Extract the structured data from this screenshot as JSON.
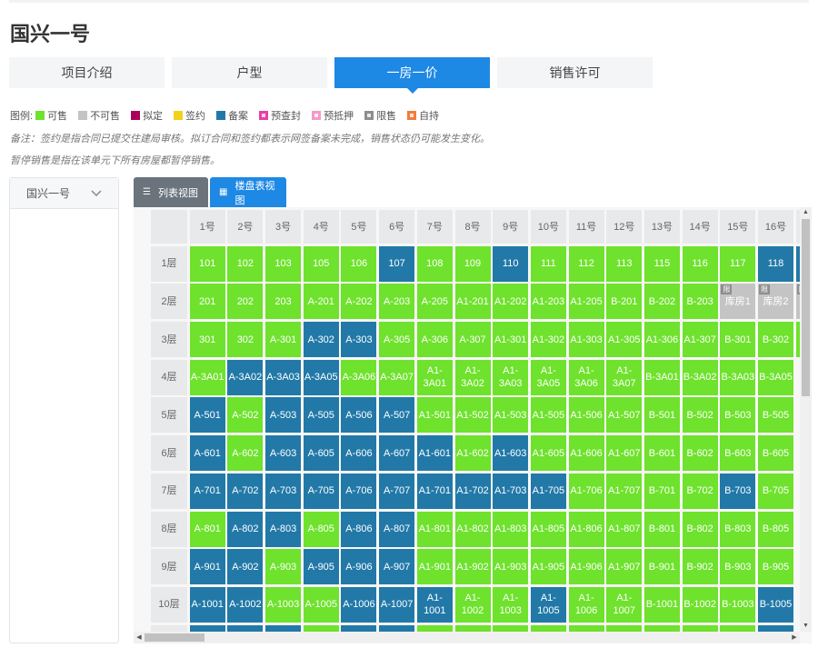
{
  "title": "国兴一号",
  "tabs": [
    {
      "label": "项目介绍",
      "active": false
    },
    {
      "label": "户型",
      "active": false
    },
    {
      "label": "一房一价",
      "active": true
    },
    {
      "label": "销售许可",
      "active": false
    }
  ],
  "legend": {
    "prefix": "图例:",
    "items": [
      {
        "label": "可售",
        "color": "#6ee22c"
      },
      {
        "label": "不可售",
        "color": "#c4c4c4"
      },
      {
        "label": "拟定",
        "color": "#a8005a"
      },
      {
        "label": "签约",
        "color": "#f2d21e"
      },
      {
        "label": "备案",
        "color": "#2279a8"
      },
      {
        "label": "预查封",
        "color": "#e83fa9",
        "dot": true
      },
      {
        "label": "预抵押",
        "color": "#f49ac8",
        "dot": true
      },
      {
        "label": "限售",
        "color": "#8e8e8e",
        "dot": true
      },
      {
        "label": "自持",
        "color": "#f27b3b",
        "dot": true
      }
    ]
  },
  "notes": [
    "备注：签约是指合同已提交住建局审核。拟订合同和签约都表示网签备案未完成，销售状态仍可能发生变化。",
    "暂停销售是指在该单元下所有房屋都暂停销售。"
  ],
  "sidebar": {
    "building": "国兴一号"
  },
  "view_tabs": {
    "list": "列表视图",
    "grid": "楼盘表视图",
    "active": "grid"
  },
  "status_colors": {
    "a": "#6ee22c",
    "b": "#2279a8",
    "x": "#c4c4c4"
  },
  "restricted_badge": "限",
  "grid": {
    "columns": [
      "1号",
      "2号",
      "3号",
      "4号",
      "5号",
      "6号",
      "7号",
      "8号",
      "9号",
      "10号",
      "11号",
      "12号",
      "13号",
      "14号",
      "15号",
      "16号",
      ""
    ],
    "rows": [
      {
        "floor": "1层",
        "cells": [
          [
            "101",
            "a"
          ],
          [
            "102",
            "a"
          ],
          [
            "103",
            "a"
          ],
          [
            "105",
            "a"
          ],
          [
            "106",
            "a"
          ],
          [
            "107",
            "b"
          ],
          [
            "108",
            "a"
          ],
          [
            "109",
            "a"
          ],
          [
            "110",
            "b"
          ],
          [
            "111",
            "a"
          ],
          [
            "112",
            "a"
          ],
          [
            "113",
            "a"
          ],
          [
            "115",
            "a"
          ],
          [
            "116",
            "a"
          ],
          [
            "117",
            "a"
          ],
          [
            "118",
            "b"
          ],
          [
            "",
            "b"
          ]
        ]
      },
      {
        "floor": "2层",
        "cells": [
          [
            "201",
            "a"
          ],
          [
            "202",
            "a"
          ],
          [
            "203",
            "a"
          ],
          [
            "A-201",
            "a"
          ],
          [
            "A-202",
            "a"
          ],
          [
            "A-203",
            "a"
          ],
          [
            "A-205",
            "a"
          ],
          [
            "A1-201",
            "a"
          ],
          [
            "A1-202",
            "a"
          ],
          [
            "A1-203",
            "a"
          ],
          [
            "A1-205",
            "a"
          ],
          [
            "B-201",
            "a"
          ],
          [
            "B-202",
            "a"
          ],
          [
            "B-203",
            "a"
          ],
          [
            "库房1",
            "x"
          ],
          [
            "库房2",
            "x"
          ],
          [
            "",
            "x"
          ]
        ]
      },
      {
        "floor": "3层",
        "cells": [
          [
            "301",
            "a"
          ],
          [
            "302",
            "a"
          ],
          [
            "A-301",
            "a"
          ],
          [
            "A-302",
            "b"
          ],
          [
            "A-303",
            "b"
          ],
          [
            "A-305",
            "a"
          ],
          [
            "A-306",
            "a"
          ],
          [
            "A-307",
            "a"
          ],
          [
            "A1-301",
            "a"
          ],
          [
            "A1-302",
            "a"
          ],
          [
            "A1-303",
            "a"
          ],
          [
            "A1-305",
            "a"
          ],
          [
            "A1-306",
            "a"
          ],
          [
            "A1-307",
            "a"
          ],
          [
            "B-301",
            "a"
          ],
          [
            "B-302",
            "a"
          ],
          [
            "",
            "a"
          ]
        ]
      },
      {
        "floor": "4层",
        "cells": [
          [
            "A-3A01",
            "a"
          ],
          [
            "A-3A02",
            "b"
          ],
          [
            "A-3A03",
            "b"
          ],
          [
            "A-3A05",
            "b"
          ],
          [
            "A-3A06",
            "a"
          ],
          [
            "A-3A07",
            "a"
          ],
          [
            "A1-3A01",
            "a"
          ],
          [
            "A1-3A02",
            "a"
          ],
          [
            "A1-3A03",
            "a"
          ],
          [
            "A1-3A05",
            "a"
          ],
          [
            "A1-3A06",
            "a"
          ],
          [
            "A1-3A07",
            "a"
          ],
          [
            "B-3A01",
            "a"
          ],
          [
            "B-3A02",
            "a"
          ],
          [
            "B-3A03",
            "a"
          ],
          [
            "B-3A05",
            "a"
          ]
        ]
      },
      {
        "floor": "5层",
        "cells": [
          [
            "A-501",
            "b"
          ],
          [
            "A-502",
            "a"
          ],
          [
            "A-503",
            "b"
          ],
          [
            "A-505",
            "b"
          ],
          [
            "A-506",
            "b"
          ],
          [
            "A-507",
            "b"
          ],
          [
            "A1-501",
            "a"
          ],
          [
            "A1-502",
            "a"
          ],
          [
            "A1-503",
            "a"
          ],
          [
            "A1-505",
            "a"
          ],
          [
            "A1-506",
            "a"
          ],
          [
            "A1-507",
            "a"
          ],
          [
            "B-501",
            "a"
          ],
          [
            "B-502",
            "a"
          ],
          [
            "B-503",
            "a"
          ],
          [
            "B-505",
            "a"
          ]
        ]
      },
      {
        "floor": "6层",
        "cells": [
          [
            "A-601",
            "b"
          ],
          [
            "A-602",
            "a"
          ],
          [
            "A-603",
            "b"
          ],
          [
            "A-605",
            "b"
          ],
          [
            "A-606",
            "b"
          ],
          [
            "A-607",
            "b"
          ],
          [
            "A1-601",
            "b"
          ],
          [
            "A1-602",
            "a"
          ],
          [
            "A1-603",
            "b"
          ],
          [
            "A1-605",
            "a"
          ],
          [
            "A1-606",
            "a"
          ],
          [
            "A1-607",
            "a"
          ],
          [
            "B-601",
            "a"
          ],
          [
            "B-602",
            "a"
          ],
          [
            "B-603",
            "a"
          ],
          [
            "B-605",
            "a"
          ]
        ]
      },
      {
        "floor": "7层",
        "cells": [
          [
            "A-701",
            "b"
          ],
          [
            "A-702",
            "b"
          ],
          [
            "A-703",
            "b"
          ],
          [
            "A-705",
            "b"
          ],
          [
            "A-706",
            "b"
          ],
          [
            "A-707",
            "b"
          ],
          [
            "A1-701",
            "b"
          ],
          [
            "A1-702",
            "b"
          ],
          [
            "A1-703",
            "b"
          ],
          [
            "A1-705",
            "b"
          ],
          [
            "A1-706",
            "a"
          ],
          [
            "A1-707",
            "a"
          ],
          [
            "B-701",
            "a"
          ],
          [
            "B-702",
            "a"
          ],
          [
            "B-703",
            "b"
          ],
          [
            "B-705",
            "a"
          ]
        ]
      },
      {
        "floor": "8层",
        "cells": [
          [
            "A-801",
            "a"
          ],
          [
            "A-802",
            "b"
          ],
          [
            "A-803",
            "b"
          ],
          [
            "A-805",
            "a"
          ],
          [
            "A-806",
            "b"
          ],
          [
            "A-807",
            "b"
          ],
          [
            "A1-801",
            "a"
          ],
          [
            "A1-802",
            "a"
          ],
          [
            "A1-803",
            "a"
          ],
          [
            "A1-805",
            "a"
          ],
          [
            "A1-806",
            "a"
          ],
          [
            "A1-807",
            "a"
          ],
          [
            "B-801",
            "a"
          ],
          [
            "B-802",
            "a"
          ],
          [
            "B-803",
            "a"
          ],
          [
            "B-805",
            "a"
          ]
        ]
      },
      {
        "floor": "9层",
        "cells": [
          [
            "A-901",
            "b"
          ],
          [
            "A-902",
            "b"
          ],
          [
            "A-903",
            "a"
          ],
          [
            "A-905",
            "b"
          ],
          [
            "A-906",
            "b"
          ],
          [
            "A-907",
            "b"
          ],
          [
            "A1-901",
            "a"
          ],
          [
            "A1-902",
            "a"
          ],
          [
            "A1-903",
            "a"
          ],
          [
            "A1-905",
            "a"
          ],
          [
            "A1-906",
            "a"
          ],
          [
            "A1-907",
            "a"
          ],
          [
            "B-901",
            "a"
          ],
          [
            "B-902",
            "a"
          ],
          [
            "B-903",
            "a"
          ],
          [
            "B-905",
            "a"
          ]
        ]
      },
      {
        "floor": "10层",
        "cells": [
          [
            "A-1001",
            "b"
          ],
          [
            "A-1002",
            "b"
          ],
          [
            "A-1003",
            "a"
          ],
          [
            "A-1005",
            "a"
          ],
          [
            "A-1006",
            "b"
          ],
          [
            "A-1007",
            "b"
          ],
          [
            "A1-1001",
            "b"
          ],
          [
            "A1-1002",
            "a"
          ],
          [
            "A1-1003",
            "a"
          ],
          [
            "A1-1005",
            "b"
          ],
          [
            "A1-1006",
            "a"
          ],
          [
            "A1-1007",
            "a"
          ],
          [
            "B-1001",
            "a"
          ],
          [
            "B-1002",
            "a"
          ],
          [
            "B-1003",
            "a"
          ],
          [
            "B-1005",
            "b"
          ]
        ]
      },
      {
        "floor": "",
        "cells": [
          [
            "",
            "b"
          ],
          [
            "",
            "b"
          ],
          [
            "",
            "b"
          ],
          [
            "",
            "a"
          ],
          [
            "",
            "b"
          ],
          [
            "",
            "b"
          ],
          [
            "",
            "a"
          ],
          [
            "",
            "a"
          ],
          [
            "",
            "a"
          ],
          [
            "",
            "a"
          ],
          [
            "",
            "a"
          ],
          [
            "",
            "a"
          ],
          [
            "",
            "a"
          ],
          [
            "",
            "a"
          ],
          [
            "",
            "a"
          ],
          [
            "",
            "b"
          ]
        ]
      }
    ]
  }
}
